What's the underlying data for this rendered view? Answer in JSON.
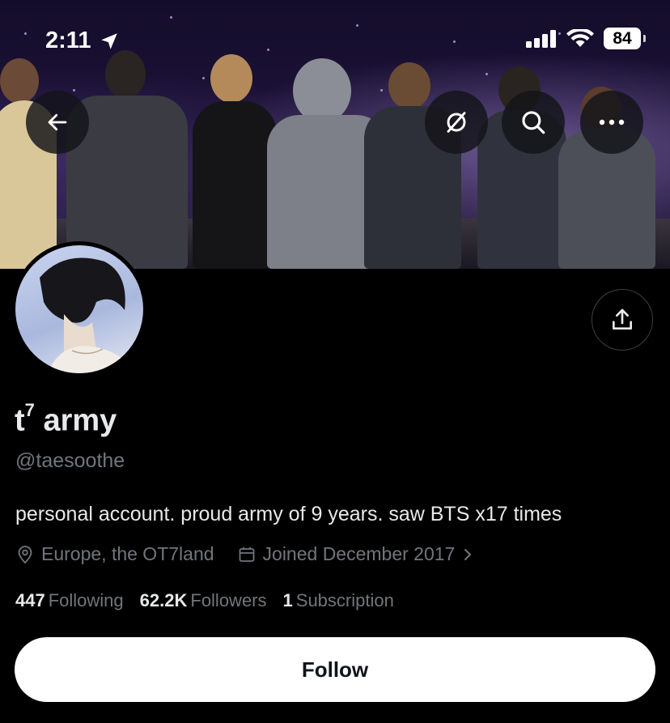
{
  "status_bar": {
    "time": "2:11",
    "battery": "84"
  },
  "nav": {
    "back_icon": "arrow-left-icon",
    "grok_icon": "slashed-circle-icon",
    "search_icon": "search-icon",
    "more_icon": "ellipsis-icon"
  },
  "profile": {
    "display_name": "t",
    "display_name_sup": "7",
    "display_name_rest": " army",
    "handle": "@taesoothe",
    "bio": "personal account. proud army of 9 years. saw BTS x17 times",
    "location": "Europe, the OT7land",
    "joined": "Joined December 2017"
  },
  "stats": {
    "following_count": "447",
    "following_label": "Following",
    "followers_count": "62.2K",
    "followers_label": "Followers",
    "subscription_count": "1",
    "subscription_label": "Subscription"
  },
  "actions": {
    "follow_label": "Follow",
    "share_icon": "share-upload-icon"
  },
  "colors": {
    "background": "#000000",
    "primary_text": "#e7e9ea",
    "secondary_text": "#71767b",
    "follow_button_bg": "#ffffff"
  }
}
